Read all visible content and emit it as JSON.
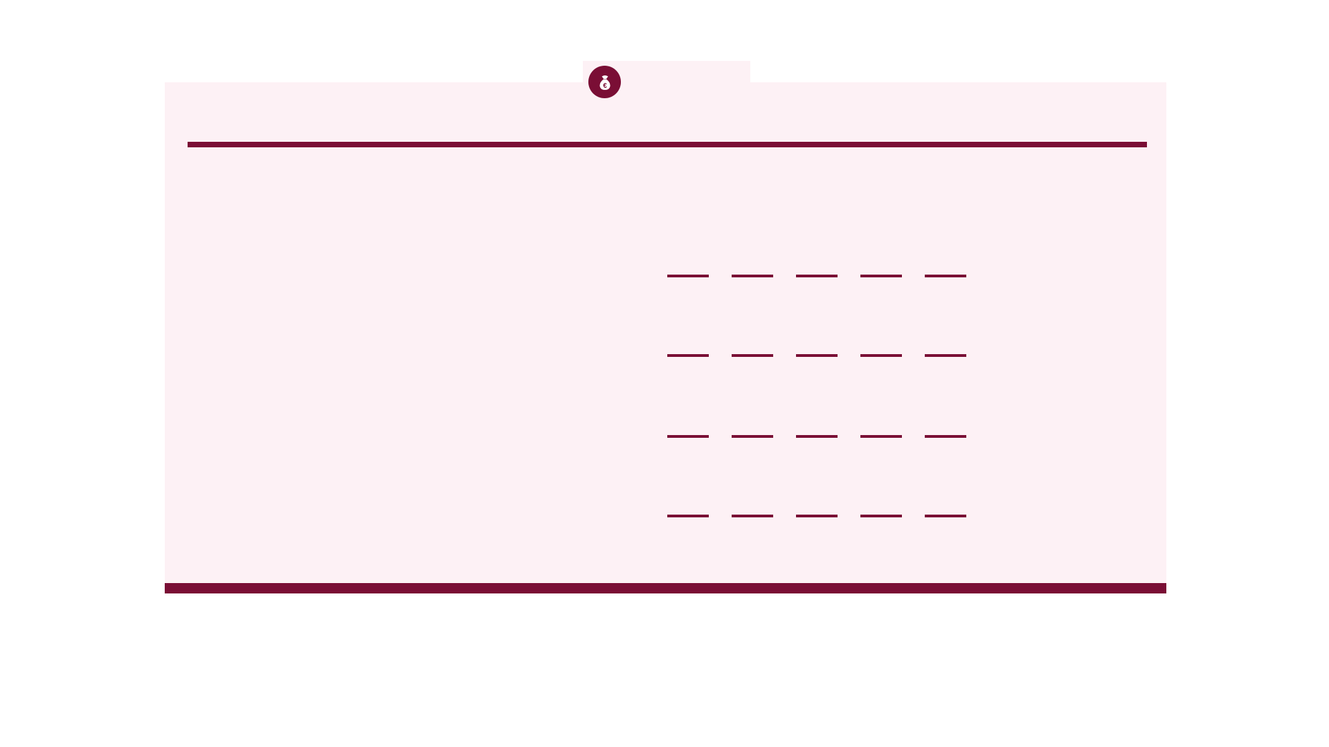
{
  "theme": {
    "accent": "#7a0e35",
    "panel": "#fdf1f5",
    "background": "#ffffff"
  },
  "header": {
    "icon": "money-bag-euro-icon",
    "icon_glyph": "€"
  },
  "placeholder_grid": {
    "rows": 4,
    "columns": 5
  }
}
